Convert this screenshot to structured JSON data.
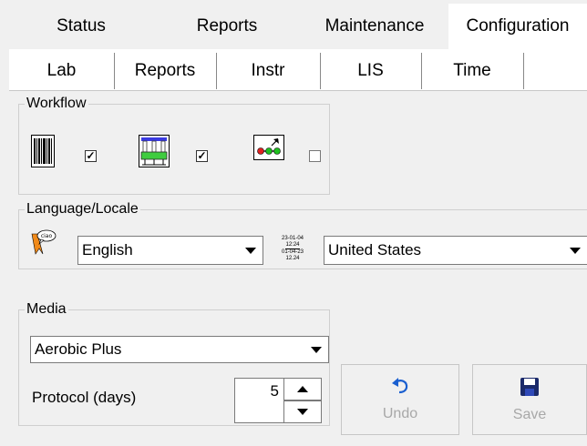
{
  "tabs_top": [
    "Status",
    "Reports",
    "Maintenance",
    "Configuration"
  ],
  "tabs_sub": [
    "Lab",
    "Reports",
    "Instr",
    "LIS",
    "Time"
  ],
  "workflow": {
    "legend": "Workflow",
    "items": [
      {
        "icon": "barcode-icon",
        "checked": true
      },
      {
        "icon": "rack-icon",
        "checked": true
      },
      {
        "icon": "transfer-icon",
        "checked": false
      }
    ]
  },
  "language": {
    "legend": "Language/Locale",
    "language_value": "English",
    "region_value": "United States",
    "date_icon_lines": [
      "23-01-04",
      "12:24",
      "01-04-23",
      "12.24"
    ]
  },
  "media": {
    "legend": "Media",
    "media_value": "Aerobic Plus",
    "protocol_label": "Protocol (days)",
    "protocol_value": "5"
  },
  "actions": {
    "undo_label": "Undo",
    "save_label": "Save"
  },
  "colors": {
    "accent": "#1a5fd0",
    "disabled_text": "#a8a8a8"
  }
}
